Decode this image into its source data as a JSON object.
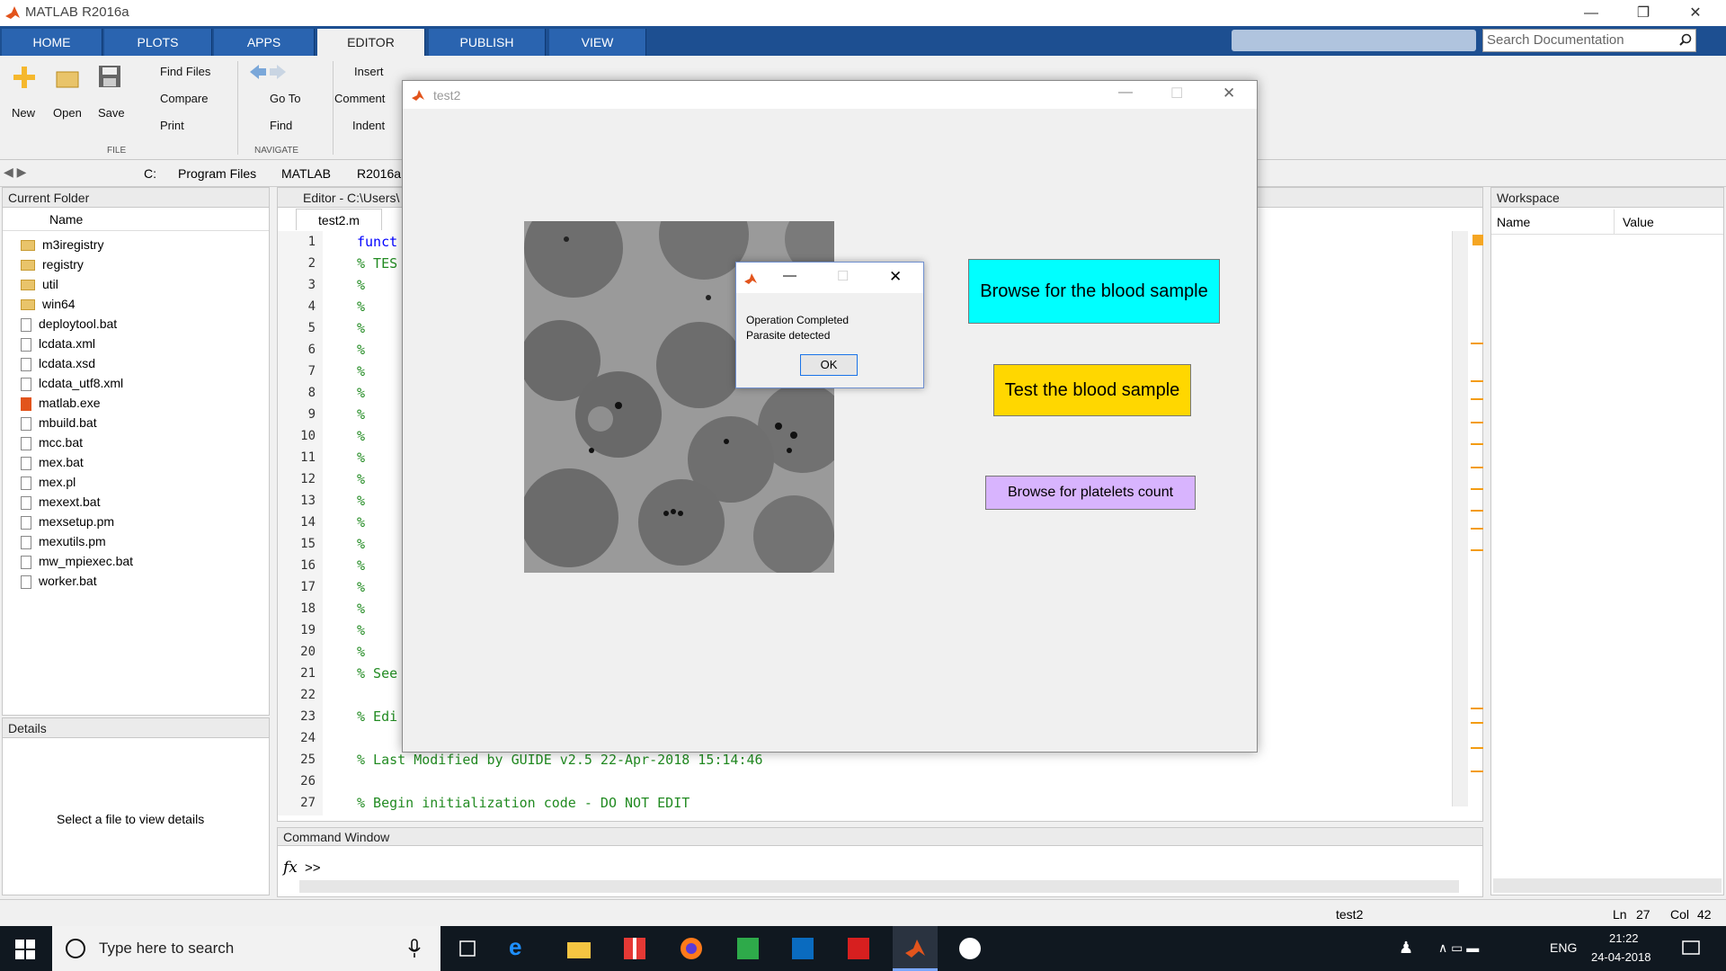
{
  "app": {
    "title": "MATLAB R2016a"
  },
  "tabs": [
    "HOME",
    "PLOTS",
    "APPS",
    "EDITOR",
    "PUBLISH",
    "VIEW"
  ],
  "search": {
    "placeholder": "Search Documentation"
  },
  "ribbon": {
    "file": {
      "new": "New",
      "open": "Open",
      "save": "Save",
      "find_files": "Find Files",
      "compare": "Compare",
      "print": "Print",
      "group": "FILE"
    },
    "navigate": {
      "go_to": "Go To",
      "find": "Find",
      "group": "NAVIGATE"
    },
    "edit": {
      "insert": "Insert",
      "comment": "Comment",
      "indent": "Indent"
    }
  },
  "path": [
    "C:",
    "Program Files",
    "MATLAB",
    "R2016a"
  ],
  "current_folder": {
    "header": "Current Folder",
    "column": "Name",
    "items": [
      {
        "name": "m3iregistry",
        "kind": "folder"
      },
      {
        "name": "registry",
        "kind": "folder"
      },
      {
        "name": "util",
        "kind": "folder"
      },
      {
        "name": "win64",
        "kind": "folder"
      },
      {
        "name": "deploytool.bat",
        "kind": "file"
      },
      {
        "name": "lcdata.xml",
        "kind": "file"
      },
      {
        "name": "lcdata.xsd",
        "kind": "file"
      },
      {
        "name": "lcdata_utf8.xml",
        "kind": "file"
      },
      {
        "name": "matlab.exe",
        "kind": "exe"
      },
      {
        "name": "mbuild.bat",
        "kind": "file"
      },
      {
        "name": "mcc.bat",
        "kind": "file"
      },
      {
        "name": "mex.bat",
        "kind": "file"
      },
      {
        "name": "mex.pl",
        "kind": "file"
      },
      {
        "name": "mexext.bat",
        "kind": "file"
      },
      {
        "name": "mexsetup.pm",
        "kind": "file"
      },
      {
        "name": "mexutils.pm",
        "kind": "file"
      },
      {
        "name": "mw_mpiexec.bat",
        "kind": "file"
      },
      {
        "name": "worker.bat",
        "kind": "file"
      }
    ]
  },
  "details": {
    "header": "Details",
    "message": "Select a file to view details"
  },
  "editor": {
    "header": "Editor - C:\\Users\\",
    "tab": "test2.m",
    "lines": [
      {
        "n": "1",
        "t": "funct"
      },
      {
        "n": "2",
        "t": "% TES"
      },
      {
        "n": "3",
        "t": "%"
      },
      {
        "n": "4",
        "t": "%"
      },
      {
        "n": "5",
        "t": "%"
      },
      {
        "n": "6",
        "t": "%"
      },
      {
        "n": "7",
        "t": "%"
      },
      {
        "n": "8",
        "t": "%"
      },
      {
        "n": "9",
        "t": "%"
      },
      {
        "n": "10",
        "t": "%"
      },
      {
        "n": "11",
        "t": "%"
      },
      {
        "n": "12",
        "t": "%"
      },
      {
        "n": "13",
        "t": "%"
      },
      {
        "n": "14",
        "t": "%"
      },
      {
        "n": "15",
        "t": "%"
      },
      {
        "n": "16",
        "t": "%"
      },
      {
        "n": "17",
        "t": "%"
      },
      {
        "n": "18",
        "t": "%"
      },
      {
        "n": "19",
        "t": "%"
      },
      {
        "n": "20",
        "t": "%"
      },
      {
        "n": "21",
        "t": "% See"
      },
      {
        "n": "22",
        "t": ""
      },
      {
        "n": "23",
        "t": "% Edi"
      },
      {
        "n": "24",
        "t": ""
      },
      {
        "n": "25",
        "t": "% Last Modified by GUIDE v2.5 22-Apr-2018 15:14:46"
      },
      {
        "n": "26",
        "t": ""
      },
      {
        "n": "27",
        "t": "% Begin initialization code - DO NOT EDIT"
      }
    ]
  },
  "command_window": {
    "header": "Command Window",
    "prompt": ">>"
  },
  "workspace": {
    "header": "Workspace",
    "col_name": "Name",
    "col_value": "Value"
  },
  "status": {
    "file": "test2",
    "ln_label": "Ln",
    "ln": "27",
    "col_label": "Col",
    "col": "42"
  },
  "gui": {
    "title": "test2",
    "btn_browse": "Browse for the blood sample",
    "btn_test": "Test the blood sample",
    "btn_platelets": "Browse for platelets count",
    "btn_browse_color": "#00ffff",
    "btn_test_color": "#ffd700",
    "btn_platelets_color": "#d8b4fe"
  },
  "msgbox": {
    "line1": "Operation Completed",
    "line2": "Parasite detected",
    "ok": "OK"
  },
  "taskbar": {
    "search": "Type here to search",
    "lang": "ENG",
    "time": "21:22",
    "date": "24-04-2018"
  }
}
